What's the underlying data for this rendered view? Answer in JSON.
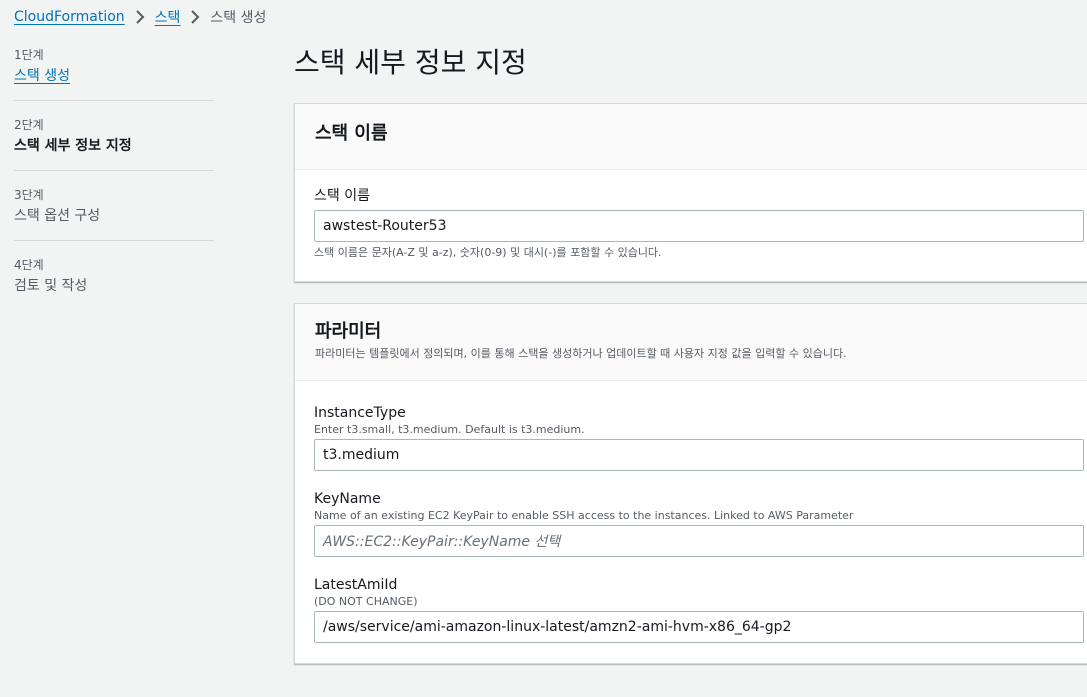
{
  "breadcrumb": {
    "items": [
      {
        "label": "CloudFormation"
      },
      {
        "label": "스택"
      },
      {
        "label": "스택 생성"
      }
    ]
  },
  "steps": [
    {
      "num": "1단계",
      "label": "스택 생성"
    },
    {
      "num": "2단계",
      "label": "스택 세부 정보 지정"
    },
    {
      "num": "3단계",
      "label": "스택 옵션 구성"
    },
    {
      "num": "4단계",
      "label": "검토 및 작성"
    }
  ],
  "page_title": "스택 세부 정보 지정",
  "stack_name_panel": {
    "title": "스택 이름",
    "field_label": "스택 이름",
    "value": "awstest-Router53",
    "hint": "스택 이름은 문자(A-Z 및 a-z), 숫자(0-9) 및 대시(-)를 포함할 수 있습니다."
  },
  "parameters_panel": {
    "title": "파라미터",
    "description": "파라미터는 템플릿에서 정의되며, 이를 통해 스택을 생성하거나 업데이트할 때 사용자 지정 값을 입력할 수 있습니다.",
    "fields": [
      {
        "label": "InstanceType",
        "desc": "Enter t3.small, t3.medium. Default is t3.medium.",
        "value": "t3.medium"
      },
      {
        "label": "KeyName",
        "desc": "Name of an existing EC2 KeyPair to enable SSH access to the instances. Linked to AWS Parameter",
        "placeholder": "AWS::EC2::KeyPair::KeyName 선택"
      },
      {
        "label": "LatestAmiId",
        "desc": "(DO NOT CHANGE)",
        "value": "/aws/service/ami-amazon-linux-latest/amzn2-ami-hvm-x86_64-gp2"
      }
    ]
  }
}
